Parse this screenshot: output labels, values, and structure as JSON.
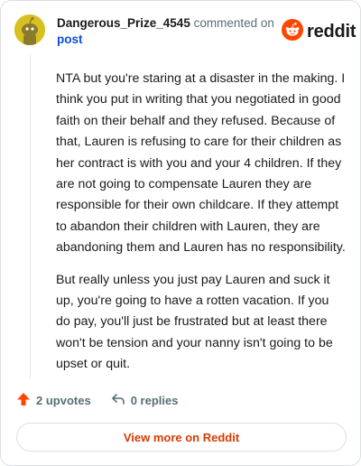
{
  "comment": {
    "username": "Dangerous_Prize_4545",
    "action_text": "commented on",
    "post_link": "post",
    "brand": "reddit",
    "body": [
      "NTA but you're staring at a disaster in the making. I think you put in writing that you negotiated in good faith on their behalf and they refused. Because of that, Lauren is refusing to care for their children as her contract is with you and your 4 children. If they are not going to compensate Lauren they are responsible for their own childcare. If they attempt to abandon their children with Lauren, they are abandoning them and Lauren has no responsibility.",
      "But really unless you just pay Lauren and suck it up, you're going to have a rotten vacation. If you do pay, you'll just be frustrated but at least there won't be tension and your nanny isn't going to be upset or quit."
    ]
  },
  "footer": {
    "upvotes": "2 upvotes",
    "replies": "0 replies",
    "view_more": "View more on Reddit"
  },
  "colors": {
    "accent": "#ff4500",
    "link": "#0b4ed6",
    "view_more_text": "#d93a00",
    "avatar_bg": "#d7c021"
  },
  "icons": {
    "avatar": "snoo-avatar-icon",
    "brand": "reddit-logo-icon",
    "upvote": "upvote-arrow-icon",
    "reply": "reply-arrow-icon"
  }
}
